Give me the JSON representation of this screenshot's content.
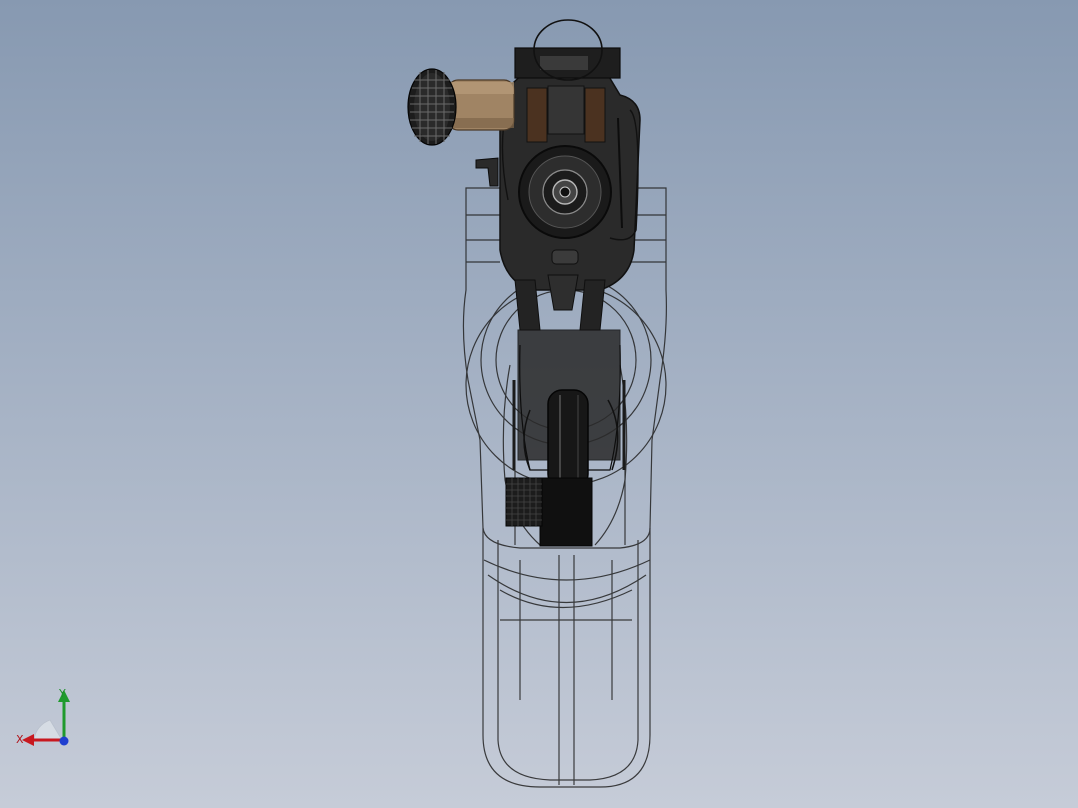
{
  "triad": {
    "x_label": "X",
    "y_label": "Y",
    "x_color": "#c8181f",
    "y_color": "#1f9a2d",
    "z_color": "#1f3fd0"
  },
  "model": {
    "icon": "pistol-model-wireframe",
    "outline_color": "#1b1b1b",
    "accent_color": "#a08464"
  }
}
